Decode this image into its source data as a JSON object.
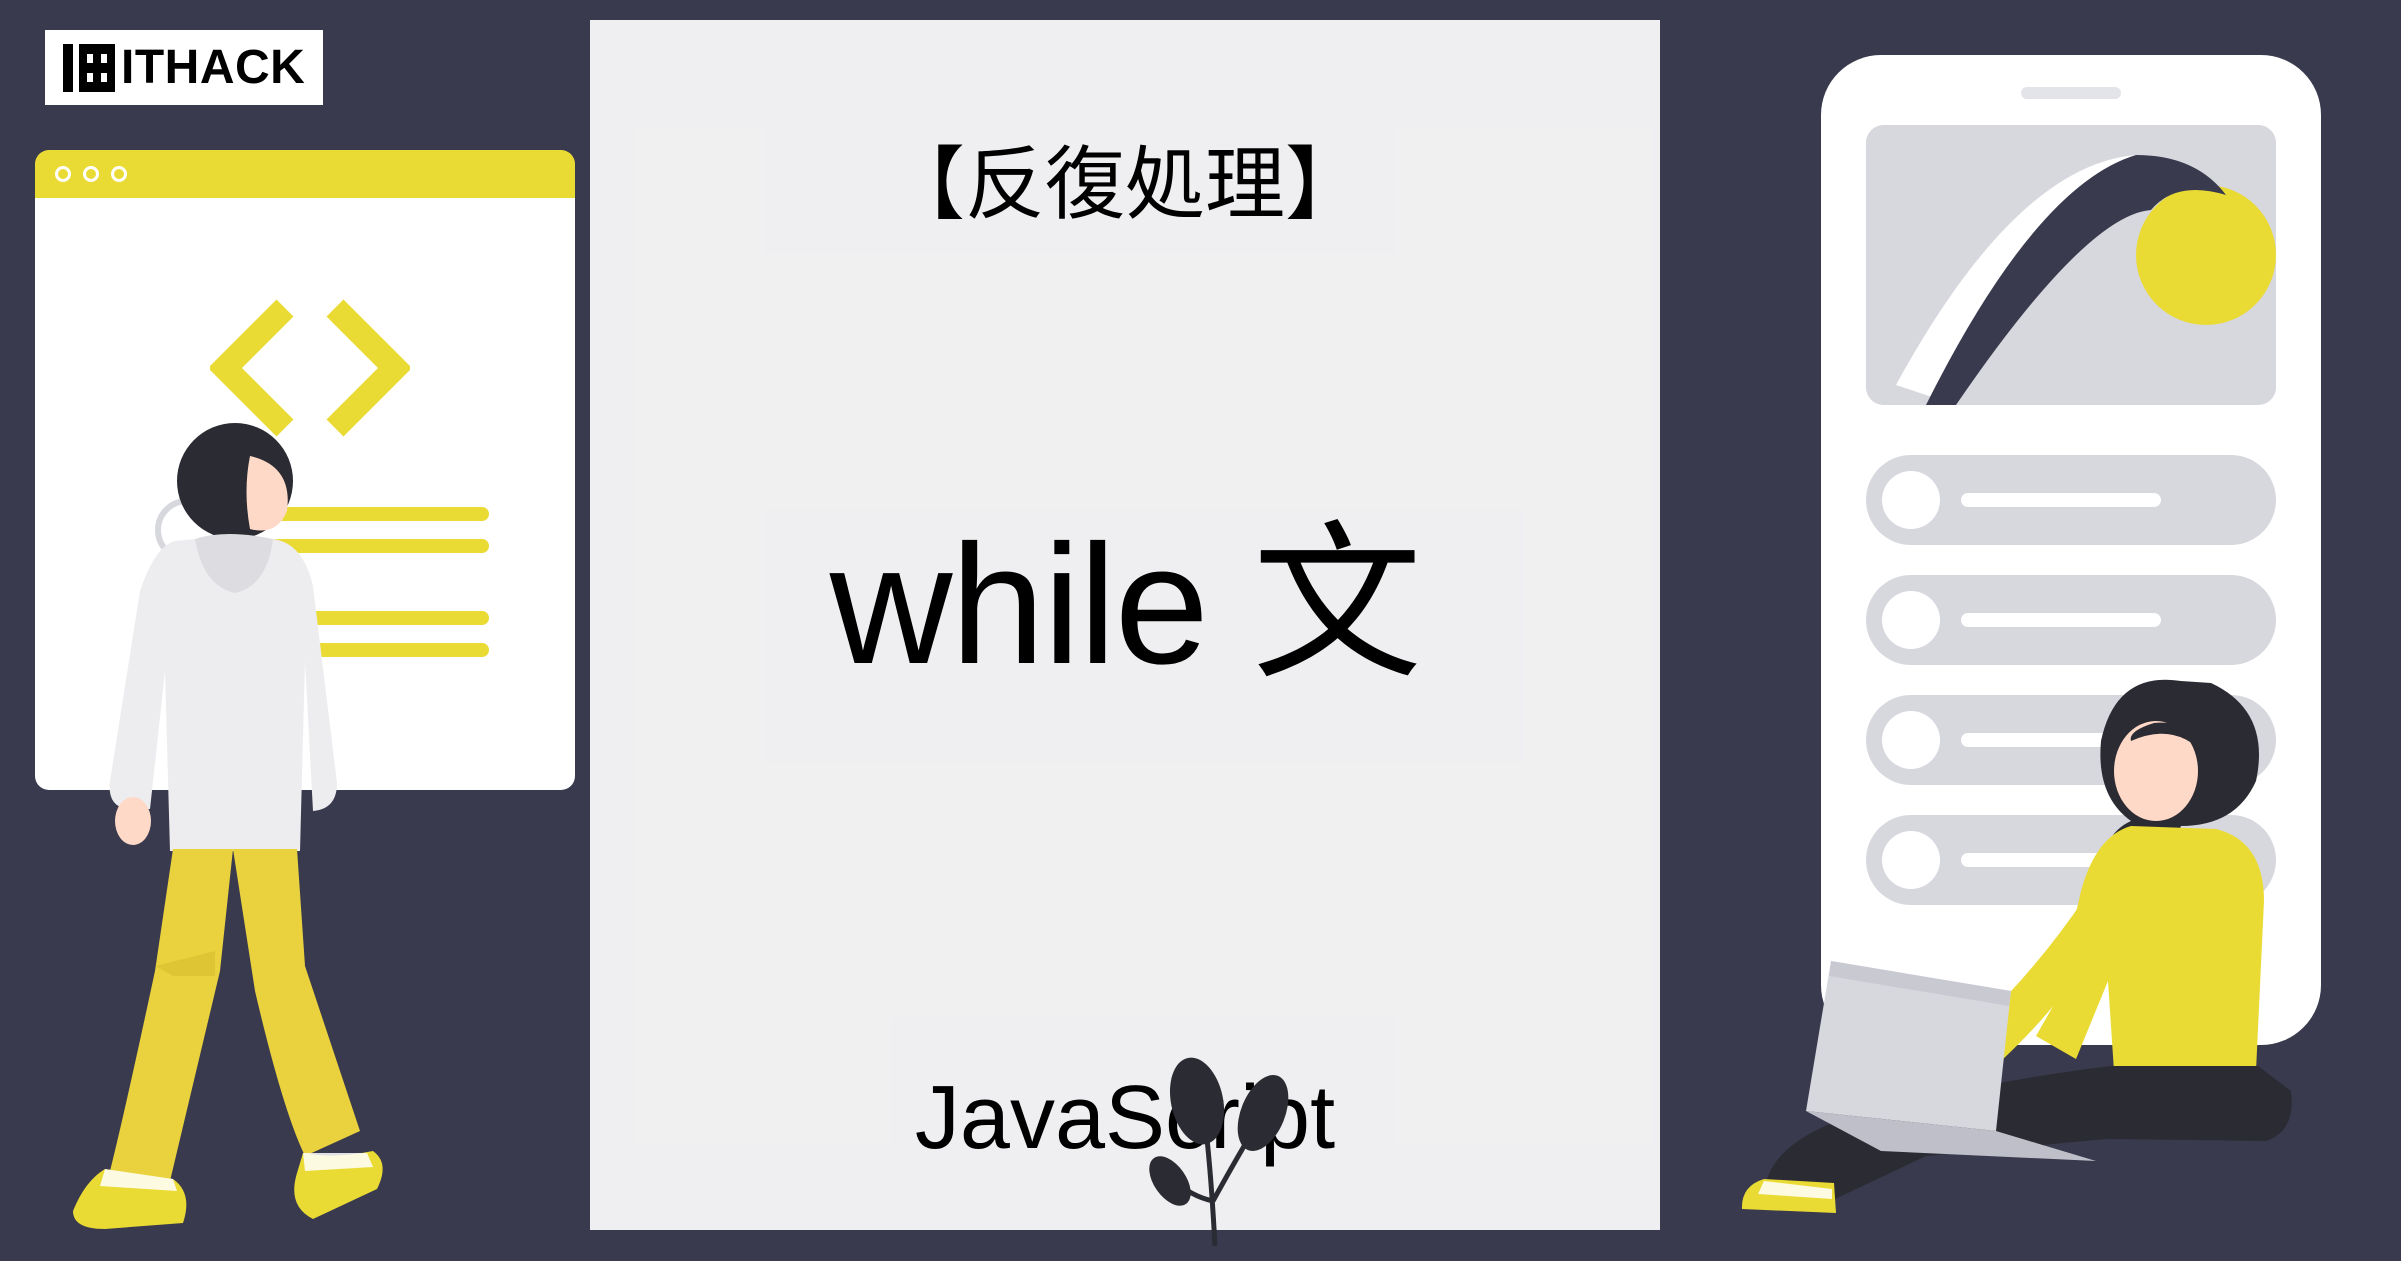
{
  "logo": {
    "text": "ITHACK"
  },
  "card": {
    "subtitle": "【反復処理】",
    "title": "while 文",
    "language": "JavaScript"
  },
  "colors": {
    "background": "#3a3a4e",
    "accent_yellow": "#eadb34",
    "skin": "#ffd9c7",
    "hair_dark": "#2b2b33",
    "pants_yellow": "#ead23e",
    "ui_gray": "#d7d7de"
  },
  "icons": {
    "logo": "logo-icon",
    "code_brackets": "code-brackets-icon"
  }
}
